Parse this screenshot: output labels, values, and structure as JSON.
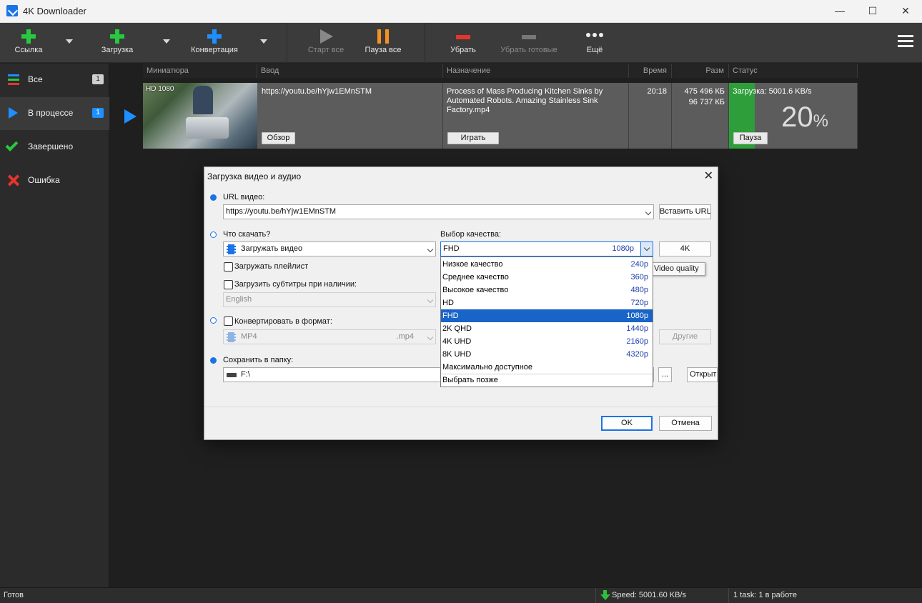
{
  "window": {
    "title": "4K Downloader",
    "minimize": "—",
    "maximize": "☐",
    "close": "✕"
  },
  "toolbar": {
    "link_label": "Ссылка",
    "download_label": "Загрузка",
    "convert_label": "Конвертация",
    "start_all_label": "Старт все",
    "pause_all_label": "Пауза все",
    "remove_label": "Убрать",
    "remove_done_label": "Убрать готовые",
    "more_label": "Ещё"
  },
  "sidebar": {
    "items": [
      {
        "label": "Все",
        "count": "1"
      },
      {
        "label": "В процессе",
        "count": "1"
      },
      {
        "label": "Завершено"
      },
      {
        "label": "Ошибка"
      }
    ]
  },
  "table": {
    "columns": [
      "Миниатюра",
      "Ввод",
      "Назначение",
      "Время",
      "Разм",
      "Статус"
    ],
    "row": {
      "quality_tag": "HD 1080",
      "input_url": "https://youtu.be/hYjw1EMnSTM",
      "browse_label": "Обзор",
      "destination": "Process of Mass Producing Kitchen Sinks by Automated Robots. Amazing Stainless Sink Factory.mp4",
      "play_label": "Играть",
      "time": "20:18",
      "size_total": "475 496 КБ",
      "size_done": "96 737 КБ",
      "status_text": "Загрузка: 5001.6 KB/s",
      "percent_number": "20",
      "percent_sign": "%",
      "progress": 0.2,
      "pause_label": "Пауза"
    }
  },
  "statusbar": {
    "left": "Готов",
    "speed": "Speed: 5001.60 KB/s",
    "tasks": "1 task: 1 в работе"
  },
  "dialog": {
    "title": "Загрузка видео и аудио",
    "url_label": "URL видео:",
    "url_value": "https://youtu.be/hYjw1EMnSTM",
    "paste_url": "Вставить URL",
    "what_label": "Что скачать?",
    "what_value": "Загружать видео",
    "quality_label": "Выбор качества:",
    "quality_value": "FHD",
    "quality_res": "1080p",
    "btn_4k": "4K",
    "playlist_label": "Загружать плейлист",
    "subs_label": "Загрузить субтитры при наличии:",
    "subs_lang": "English",
    "convert_label": "Конвертировать в формат:",
    "format_value": "MP4",
    "format_ext": ".mp4",
    "other_label": "Другие",
    "save_label": "Сохранить в папку:",
    "save_path": "F:\\",
    "browse_dots": "...",
    "open_label": "Открыть",
    "ok_label": "OK",
    "cancel_label": "Отмена",
    "tooltip": "Video quality"
  },
  "quality_options": [
    {
      "name": "Низкое качество",
      "res": "240p"
    },
    {
      "name": "Среднее качество",
      "res": "360p"
    },
    {
      "name": "Высокое качество",
      "res": "480p"
    },
    {
      "name": "HD",
      "res": "720p"
    },
    {
      "name": "FHD",
      "res": "1080p"
    },
    {
      "name": "2K QHD",
      "res": "1440p"
    },
    {
      "name": "4K UHD",
      "res": "2160p"
    },
    {
      "name": "8K UHD",
      "res": "4320p"
    },
    {
      "name": "Максимально доступное",
      "res": ""
    },
    {
      "name": "Выбрать позже",
      "res": ""
    }
  ],
  "colors": {
    "accent": "#1a73e8",
    "progress": "#2e9e3a",
    "pause": "#f39222",
    "remove": "#e8332d"
  },
  "icons": {
    "link": "plus-green-icon",
    "download": "plus-green-icon",
    "convert": "plus-blue-icon",
    "start": "play-icon",
    "pause": "pause-icon",
    "remove": "minus-red-icon",
    "more": "dots-icon",
    "menu": "hamburger-icon"
  }
}
